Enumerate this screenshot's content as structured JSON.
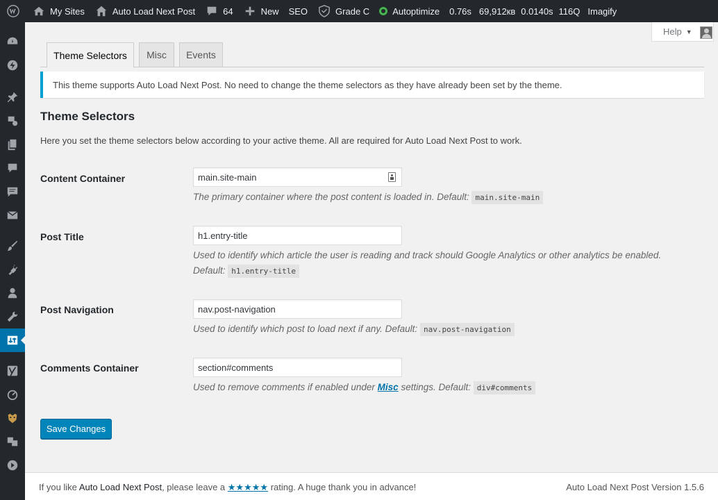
{
  "adminbar": {
    "items": [
      {
        "label": "My Sites",
        "icon": "home-sites-icon"
      },
      {
        "label": "Auto Load Next Post",
        "icon": "house-icon"
      },
      {
        "label": "64",
        "icon": "comment-bubble-icon"
      },
      {
        "label": "New",
        "icon": "plus-icon"
      },
      {
        "label": "SEO",
        "icon": ""
      },
      {
        "label": "Grade C",
        "icon": "shield-grade-icon"
      },
      {
        "label": "Autoptimize",
        "icon": "status-circle-icon"
      },
      {
        "label": "0.76s",
        "icon": ""
      },
      {
        "label": "69,912кв",
        "icon": ""
      },
      {
        "label": "0.0140s",
        "icon": ""
      },
      {
        "label": "116Q",
        "icon": ""
      },
      {
        "label": "Imagify",
        "icon": ""
      }
    ],
    "status_color": "#46b450"
  },
  "help": {
    "label": "Help"
  },
  "tabs": [
    {
      "label": "Theme Selectors",
      "active": true
    },
    {
      "label": "Misc",
      "active": false
    },
    {
      "label": "Events",
      "active": false
    }
  ],
  "notice": {
    "text": "This theme supports Auto Load Next Post. No need to change the theme selectors as they have already been set by the theme."
  },
  "section": {
    "title": "Theme Selectors",
    "description": "Here you set the theme selectors below according to your active theme. All are required for Auto Load Next Post to work."
  },
  "fields": [
    {
      "label": "Content Container",
      "value": "main.site-main",
      "desc": "The primary container where the post content is loaded in. Default:",
      "default": "main.site-main"
    },
    {
      "label": "Post Title",
      "value": "h1.entry-title",
      "desc": "Used to identify which article the user is reading and track should Google Analytics or other analytics be enabled.",
      "desc2": "Default:",
      "default": "h1.entry-title"
    },
    {
      "label": "Post Navigation",
      "value": "nav.post-navigation",
      "desc": "Used to identify which post to load next if any. Default:",
      "default": "nav.post-navigation"
    },
    {
      "label": "Comments Container",
      "value": "section#comments",
      "desc_pre": "Used to remove comments if enabled under",
      "link": "Misc",
      "desc_post": "settings. Default:",
      "default": "div#comments"
    }
  ],
  "save_button": "Save Changes",
  "footer": {
    "left_pre": "If you like",
    "plugin": "Auto Load Next Post",
    "left_mid": ", please leave a",
    "stars": "★★★★★",
    "left_post": "rating. A huge thank you in advance!",
    "version": "Auto Load Next Post Version 1.5.6"
  },
  "colors": {
    "accent": "#0073aa",
    "button": "#0085ba",
    "notice_border": "#00a0d2",
    "adminbar": "#23282d"
  }
}
